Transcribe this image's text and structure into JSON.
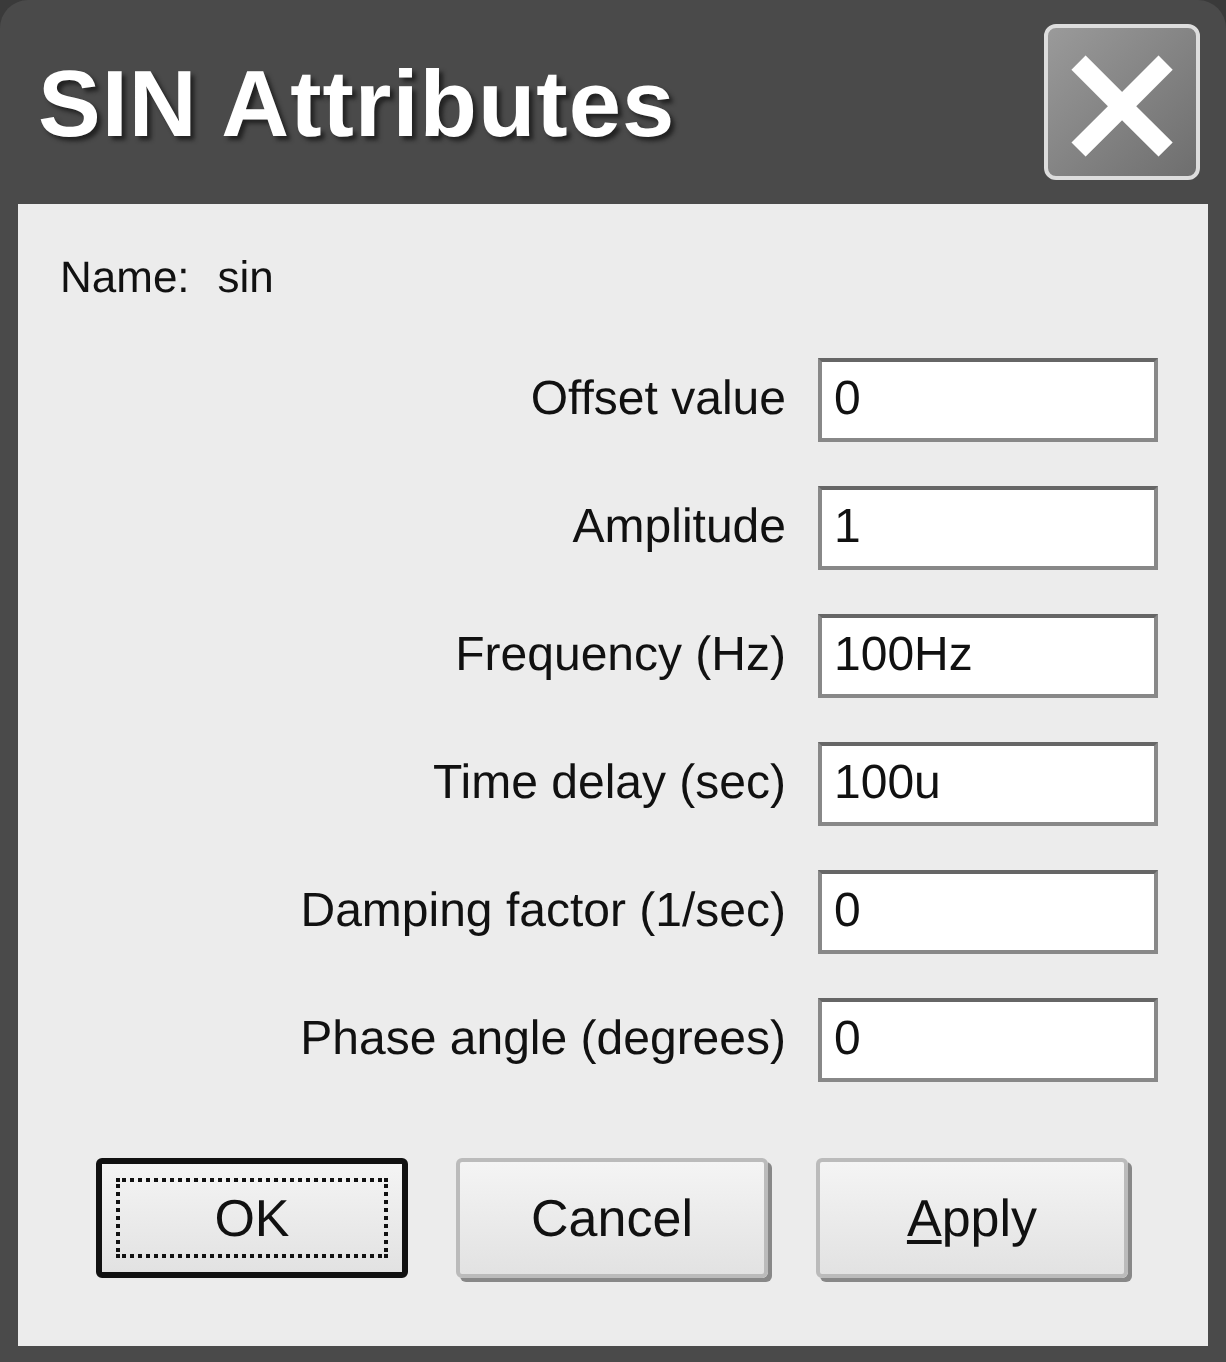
{
  "window": {
    "title": "SIN Attributes",
    "close": "×"
  },
  "name": {
    "label": "Name:",
    "value": "sin"
  },
  "fields": [
    {
      "label": "Offset value",
      "value": "0"
    },
    {
      "label": "Amplitude",
      "value": "1"
    },
    {
      "label": "Frequency (Hz)",
      "value": "100Hz"
    },
    {
      "label": "Time delay (sec)",
      "value": "100u"
    },
    {
      "label": "Damping factor (1/sec)",
      "value": "0"
    },
    {
      "label": "Phase angle (degrees)",
      "value": "0"
    }
  ],
  "buttons": [
    {
      "label": "OK",
      "default": true
    },
    {
      "label": "Cancel",
      "default": false
    },
    {
      "label": "Apply",
      "default": false,
      "first_letter_underlined": true
    }
  ]
}
